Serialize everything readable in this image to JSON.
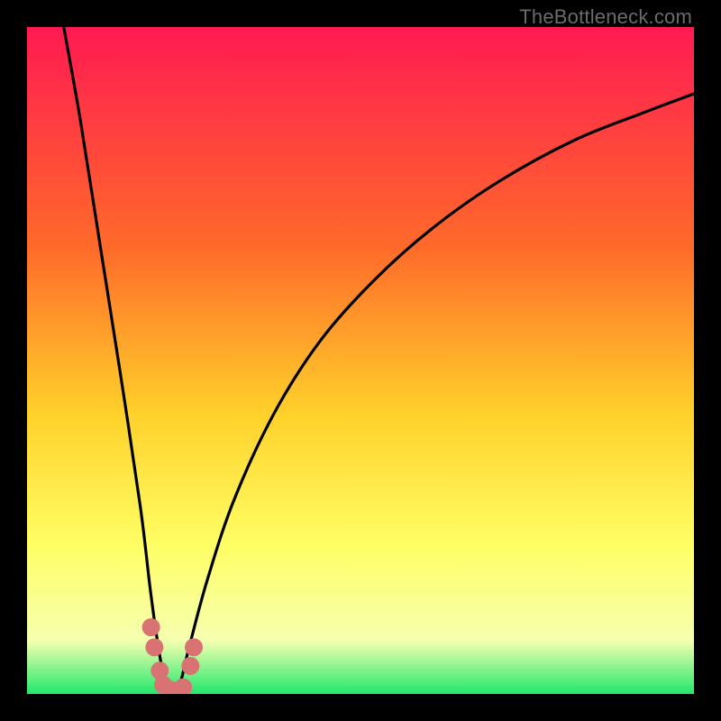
{
  "watermark": "TheBottleneck.com",
  "colors": {
    "background": "#000000",
    "gradient_top": "#ff1a52",
    "gradient_mid1": "#ff6a2a",
    "gradient_mid2": "#ffd12a",
    "gradient_mid3": "#ffff66",
    "gradient_low": "#f5ffb0",
    "gradient_bottom": "#22e86b",
    "curve": "#000000",
    "marker": "#d97373"
  },
  "chart_data": {
    "type": "line",
    "title": "",
    "xlabel": "",
    "ylabel": "",
    "xlim": [
      0,
      100
    ],
    "ylim": [
      0,
      100
    ],
    "x_min_at_zero_y": 21,
    "series": [
      {
        "name": "bottleneck-curve",
        "description": "V-shaped bottleneck severity curve; y≈0 is ideal (green), y≈100 is worst (red). Minimum near x≈21.",
        "points": [
          {
            "x": 5.5,
            "y": 100
          },
          {
            "x": 8,
            "y": 86
          },
          {
            "x": 11,
            "y": 67
          },
          {
            "x": 14,
            "y": 48
          },
          {
            "x": 17,
            "y": 28
          },
          {
            "x": 18.5,
            "y": 15.5
          },
          {
            "x": 19.7,
            "y": 7
          },
          {
            "x": 21,
            "y": 0.5
          },
          {
            "x": 22.6,
            "y": 0.5
          },
          {
            "x": 24.3,
            "y": 7
          },
          {
            "x": 27,
            "y": 17
          },
          {
            "x": 31,
            "y": 29
          },
          {
            "x": 37,
            "y": 42
          },
          {
            "x": 44,
            "y": 53
          },
          {
            "x": 52,
            "y": 62
          },
          {
            "x": 61,
            "y": 70
          },
          {
            "x": 71,
            "y": 77
          },
          {
            "x": 82,
            "y": 83
          },
          {
            "x": 92,
            "y": 87
          },
          {
            "x": 100,
            "y": 90
          }
        ]
      }
    ],
    "markers": {
      "name": "highlight-dots",
      "points": [
        {
          "x": 18.6,
          "y": 10
        },
        {
          "x": 19.1,
          "y": 7
        },
        {
          "x": 19.9,
          "y": 3.5
        },
        {
          "x": 20.4,
          "y": 1.4
        },
        {
          "x": 21.6,
          "y": 0.6
        },
        {
          "x": 23.4,
          "y": 1.0
        },
        {
          "x": 24.5,
          "y": 4.2
        },
        {
          "x": 25.0,
          "y": 7.0
        }
      ],
      "radius": 10
    }
  }
}
